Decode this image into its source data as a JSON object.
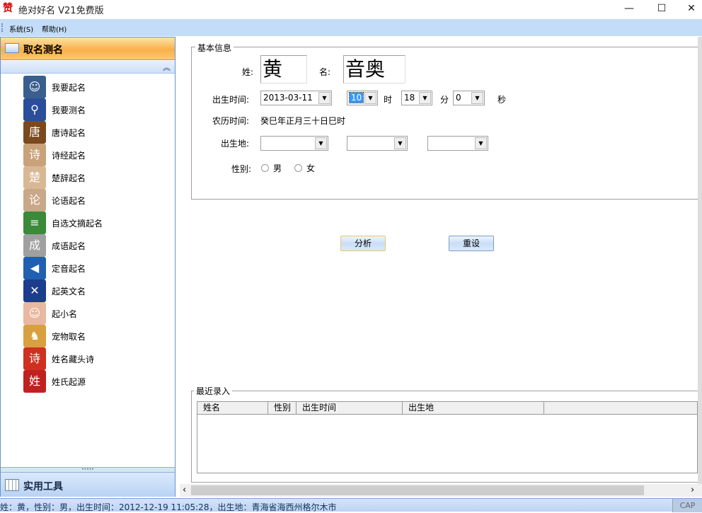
{
  "window": {
    "title": "绝对好名 V21免费版",
    "minimize": "—",
    "maximize": "☐",
    "close": "✕",
    "app_icon": "赞"
  },
  "menu": [
    "系统(S)",
    "帮助(H)"
  ],
  "sidebar": {
    "header": "取名测名",
    "collapse": "︽",
    "items": [
      {
        "label": "我要起名",
        "icon": "person",
        "color": "#3a5f8f",
        "glyph": "☺"
      },
      {
        "label": "我要测名",
        "icon": "magnifier",
        "color": "#2a4e9a",
        "glyph": "⚲"
      },
      {
        "label": "唐诗起名",
        "icon": "tang-poem",
        "color": "#7a4a1e",
        "glyph": "唐"
      },
      {
        "label": "诗经起名",
        "icon": "shijing",
        "color": "#c9a27a",
        "glyph": "诗"
      },
      {
        "label": "楚辞起名",
        "icon": "chuci",
        "color": "#d8b894",
        "glyph": "楚"
      },
      {
        "label": "论语起名",
        "icon": "lunyu",
        "color": "#c8a888",
        "glyph": "论"
      },
      {
        "label": "自选文摘起名",
        "icon": "books",
        "color": "#3a8a3a",
        "glyph": "≡"
      },
      {
        "label": "成语起名",
        "icon": "idiom",
        "color": "#a0a0a0",
        "glyph": "成"
      },
      {
        "label": "定音起名",
        "icon": "speaker",
        "color": "#2060b0",
        "glyph": "◀"
      },
      {
        "label": "起英文名",
        "icon": "uk-flag",
        "color": "#1c3c8c",
        "glyph": "✕"
      },
      {
        "label": "起小名",
        "icon": "baby",
        "color": "#e8b8a0",
        "glyph": "☺"
      },
      {
        "label": "宠物取名",
        "icon": "dog",
        "color": "#d8a040",
        "glyph": "♞"
      },
      {
        "label": "姓名藏头诗",
        "icon": "poem",
        "color": "#d03020",
        "glyph": "诗"
      },
      {
        "label": "姓氏起源",
        "icon": "surname-seal",
        "color": "#c02020",
        "glyph": "姓"
      }
    ],
    "grip": "•••••",
    "tools": "实用工具"
  },
  "basic": {
    "legend": "基本信息",
    "surname_label": "姓:",
    "surname": "黄",
    "given_label": "名:",
    "given": "音奥",
    "birth_label": "出生时间:",
    "date": "2013-03-11",
    "hour": "10",
    "hour_unit": "时",
    "minute": "18",
    "minute_unit": "分",
    "second": "0",
    "second_unit": "秒",
    "lunar_label": "农历时间:",
    "lunar": "癸巳年正月三十日巳时",
    "place_label": "出生地:",
    "gender_label": "性别:",
    "male": "男",
    "female": "女"
  },
  "buttons": {
    "analyze": "分析",
    "reset": "重设"
  },
  "recent": {
    "legend": "最近录入",
    "columns": [
      "姓名",
      "性别",
      "出生时间",
      "出生地",
      ""
    ]
  },
  "status": {
    "text": "姓：黄，性别：男，出生时间：2012-12-19 11:05:28，出生地：青海省海西州格尔木市",
    "cap": "CAP"
  },
  "scroll": {
    "left": "‹",
    "right": "›"
  }
}
